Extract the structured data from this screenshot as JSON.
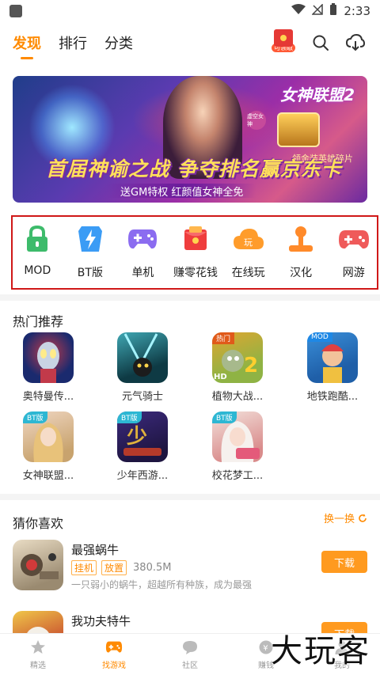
{
  "status_bar": {
    "time": "2:33"
  },
  "top_nav": {
    "tabs": [
      {
        "label": "发现",
        "active": true
      },
      {
        "label": "排行",
        "active": false
      },
      {
        "label": "分类",
        "active": false
      }
    ],
    "redpack_label": "可领取"
  },
  "banner": {
    "logo_text": "女神联盟2",
    "seal_text": "虚空女神",
    "chest_text": "领金装英雄碎片",
    "headline": "首届神谕之战 争夺排名赢京东卡",
    "subline": "送GM特权 红颜值女神全免"
  },
  "categories": [
    {
      "label": "MOD",
      "icon": "lock-icon",
      "color": "#3dbb6b"
    },
    {
      "label": "BT版",
      "icon": "lightning-shield-icon",
      "color": "#3b9cf5"
    },
    {
      "label": "单机",
      "icon": "gamepad-icon",
      "color": "#8b6cf0"
    },
    {
      "label": "赚零花钱",
      "icon": "red-envelope-icon",
      "color": "#ef3d3d"
    },
    {
      "label": "在线玩",
      "icon": "cloud-play-icon",
      "color": "#ff9c2b"
    },
    {
      "label": "汉化",
      "icon": "joystick-icon",
      "color": "#ff8a2a"
    },
    {
      "label": "网游",
      "icon": "controller-icon",
      "color": "#ef5a5a"
    }
  ],
  "hot": {
    "title": "热门推荐",
    "games": [
      {
        "name": "奥特曼传...",
        "tag": "",
        "colors": [
          "#1a2a6e",
          "#c23a4a"
        ]
      },
      {
        "name": "元气骑士",
        "tag": "",
        "colors": [
          "#0e3a44",
          "#3fa7b3"
        ]
      },
      {
        "name": "植物大战...",
        "tag": "热门",
        "colors": [
          "#8fb344",
          "#e0a630"
        ]
      },
      {
        "name": "地铁跑酷...",
        "tag": "MOD",
        "colors": [
          "#3a8fd9",
          "#f0c040"
        ]
      },
      {
        "name": "女神联盟...",
        "tag": "BT版",
        "colors": [
          "#f0d7c3",
          "#c8a36e"
        ]
      },
      {
        "name": "少年西游...",
        "tag": "BT版",
        "colors": [
          "#3c2a7e",
          "#e0b23c"
        ]
      },
      {
        "name": "校花梦工...",
        "tag": "BT版",
        "colors": [
          "#f3e2dc",
          "#d98b8b"
        ]
      }
    ]
  },
  "guess": {
    "title": "猜你喜欢",
    "refresh_label": "换一换",
    "apps": [
      {
        "name": "最强蜗牛",
        "tags": [
          "挂机",
          "放置"
        ],
        "size": "380.5M",
        "desc": "一只弱小的蜗牛，超越所有种族，成为最强",
        "button": "下载"
      },
      {
        "name": "我功夫特牛",
        "tags": [],
        "size": "",
        "desc": "",
        "button": "下载"
      }
    ]
  },
  "bottom_nav": [
    {
      "label": "精选",
      "active": false
    },
    {
      "label": "找游戏",
      "active": true
    },
    {
      "label": "社区",
      "active": false
    },
    {
      "label": "赚钱",
      "active": false
    },
    {
      "label": "我的",
      "active": false
    }
  ],
  "watermark": "大玩客"
}
